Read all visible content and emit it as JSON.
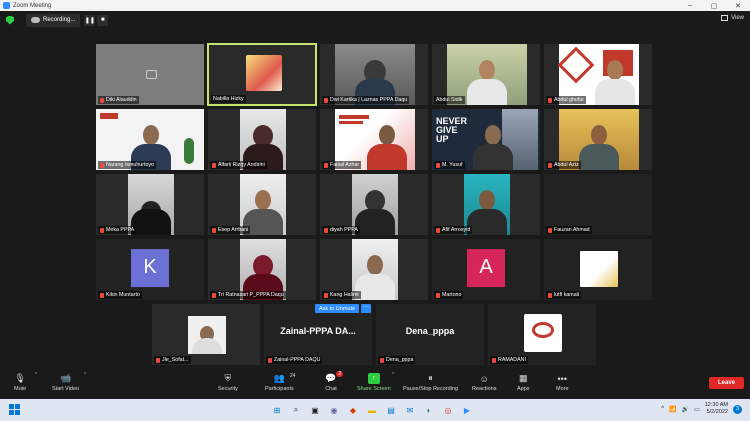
{
  "window": {
    "title": "Zoom Meeting",
    "minimize": "–",
    "maximize": "▢",
    "close": "✕"
  },
  "topbar": {
    "recording_label": "Recording...",
    "pause_icon": "❚❚",
    "stop_icon": "■",
    "view_label": "View"
  },
  "participants_tiles": [
    {
      "name": "Diki Alauddin",
      "type": "placeholder"
    },
    {
      "name": "Nabilla Hizky",
      "type": "image",
      "active": true
    },
    {
      "name": "Dwi Kartika | Laznas PPPA Daqu",
      "type": "video"
    },
    {
      "name": "Abdul Sidik",
      "type": "video"
    },
    {
      "name": "Abdul ghofur",
      "type": "video"
    },
    {
      "name": "Narang Ismuhurtoyo",
      "type": "video"
    },
    {
      "name": "Alfarii Rizqy Andirini",
      "type": "video"
    },
    {
      "name": "Faisal Azhar",
      "type": "video"
    },
    {
      "name": "M. Yusuf",
      "type": "video"
    },
    {
      "name": "Abdul Aziz",
      "type": "video"
    },
    {
      "name": "Meka PPPA",
      "type": "video"
    },
    {
      "name": "Esep Arrbani",
      "type": "video"
    },
    {
      "name": "diyah PPPA",
      "type": "video"
    },
    {
      "name": "Afif Arrosyid",
      "type": "video"
    },
    {
      "name": "Fauzan Ahmad",
      "type": "none"
    },
    {
      "name": "Kikin Muntarto",
      "type": "letter",
      "letter": "K"
    },
    {
      "name": "Tri Ratnasari P_PPPA Daqu",
      "type": "video"
    },
    {
      "name": "Kang Halimi",
      "type": "video"
    },
    {
      "name": "Martono",
      "type": "letter",
      "letter": "A"
    },
    {
      "name": "lutfi kamali",
      "type": "image"
    },
    {
      "name": "Jle_Sofat...",
      "type": "video"
    },
    {
      "name": "Zainal-PPPA DAQU",
      "type": "text",
      "display": "Zainal-PPPA  DA..."
    },
    {
      "name": "Dena_pppa",
      "type": "text",
      "display": "Dena_pppa"
    },
    {
      "name": "RAMADANI",
      "type": "logo"
    }
  ],
  "overlay": {
    "ask_unmute": "Ask to Unmute",
    "more": "···"
  },
  "toolbar": {
    "mute": "Mute",
    "start_video": "Start Video",
    "security": "Security",
    "participants": "Participants",
    "participants_count": "24",
    "chat": "Chat",
    "chat_badge": "2",
    "share_screen": "Share Screen",
    "record": "Pause/Stop Recording",
    "reactions": "Reactions",
    "apps": "Apps",
    "more": "More",
    "leave": "Leave"
  },
  "taskbar": {
    "time": "12:30 AM",
    "date": "5/2/2022",
    "notif_count": "3"
  },
  "colors": {
    "accent": "#2d8cff",
    "leave": "#e02828",
    "active_speaker": "#c8e36b",
    "share": "#2ecc40"
  }
}
